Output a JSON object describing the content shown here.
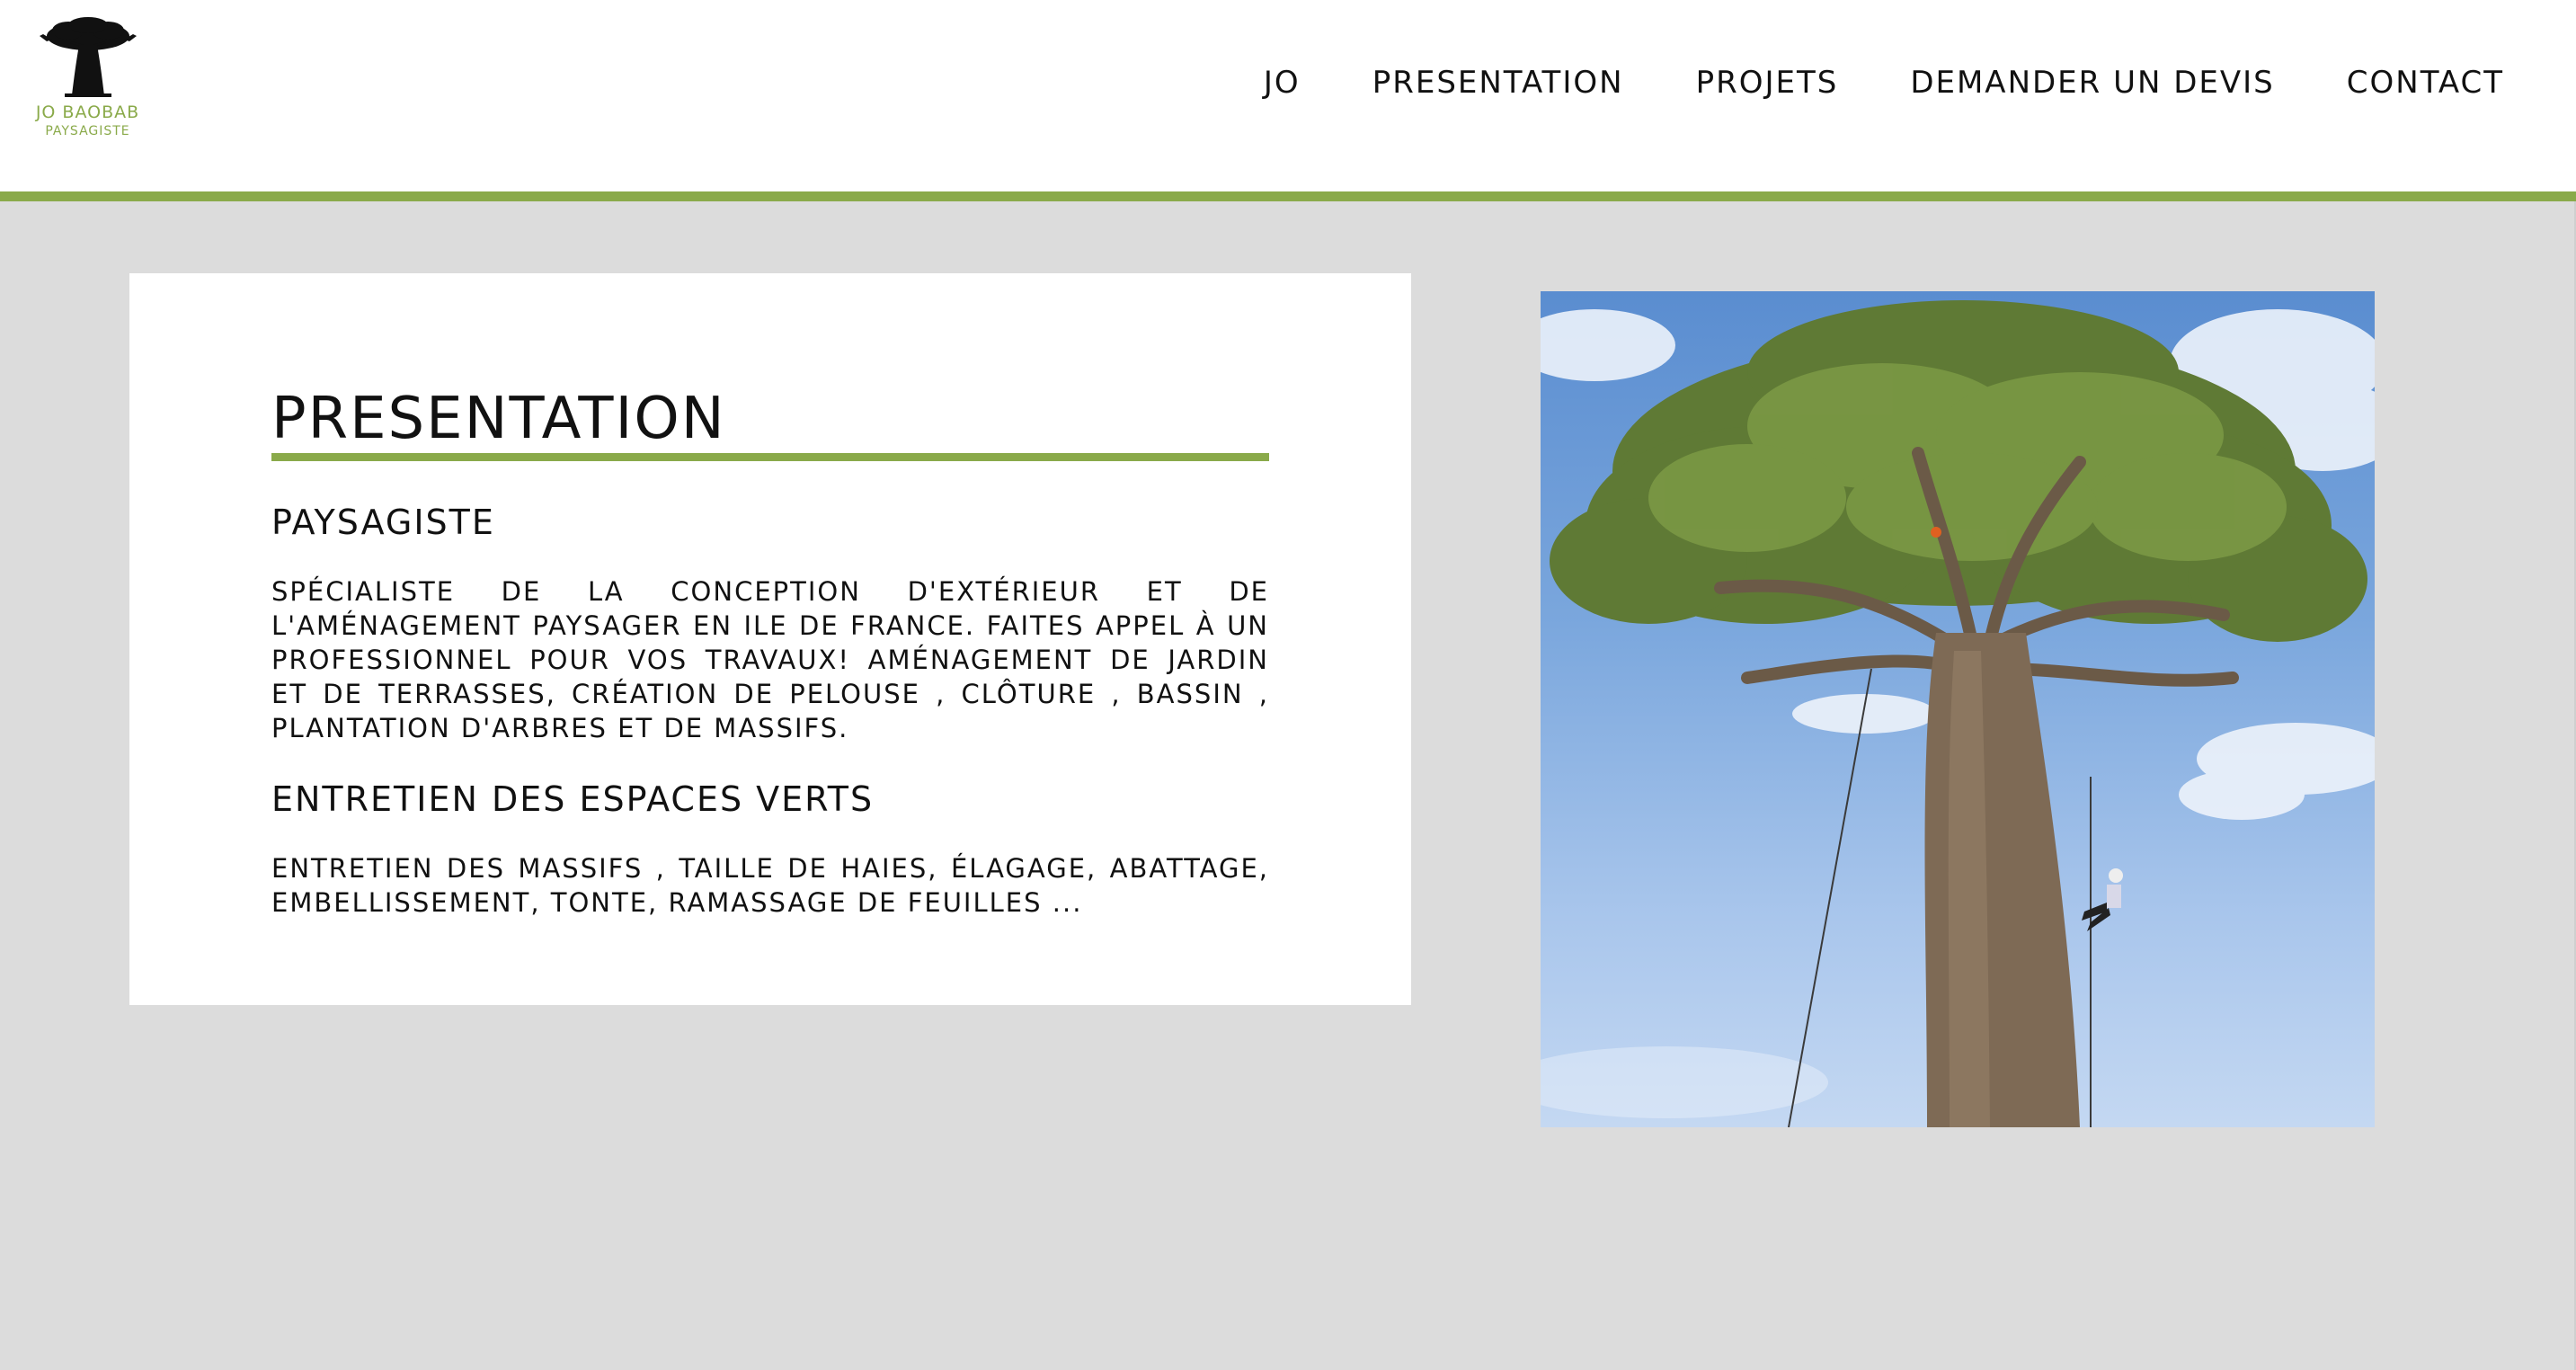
{
  "brand": {
    "name": "JO BAOBAB",
    "tagline": "PAYSAGISTE"
  },
  "nav": {
    "items": [
      {
        "label": "JO"
      },
      {
        "label": "PRESENTATION"
      },
      {
        "label": "PROJETS"
      },
      {
        "label": "DEMANDER UN DEVIS"
      },
      {
        "label": "CONTACT"
      }
    ]
  },
  "content": {
    "title": "PRESENTATION",
    "section1_heading": "PAYSAGISTE",
    "section1_text": "SPÉCIALISTE DE LA CONCEPTION D'EXTÉRIEUR ET DE L'AMÉNAGEMENT PAYSAGER EN ILE DE FRANCE. FAITES APPEL À  UN PROFESSIONNEL POUR VOS TRAVAUX! AMÉNAGEMENT DE JARDIN ET DE TERRASSES, CRÉATION DE PELOUSE , CLÔTURE , BASSIN , PLANTATION D'ARBRES ET DE MASSIFS.",
    "section2_heading": "ENTRETIEN DES ESPACES VERTS",
    "section2_text": "ENTRETIEN DES MASSIFS , TAILLE DE HAIES, ÉLAGAGE, ABATTAGE, EMBELLISSEMENT, TONTE, RAMASSAGE DE FEUILLES ..."
  },
  "colors": {
    "accent": "#8aaa4a",
    "background": "#dcdcdc",
    "card": "#ffffff",
    "text": "#111111"
  },
  "photo": {
    "subject": "baobab-tree-with-climber"
  }
}
